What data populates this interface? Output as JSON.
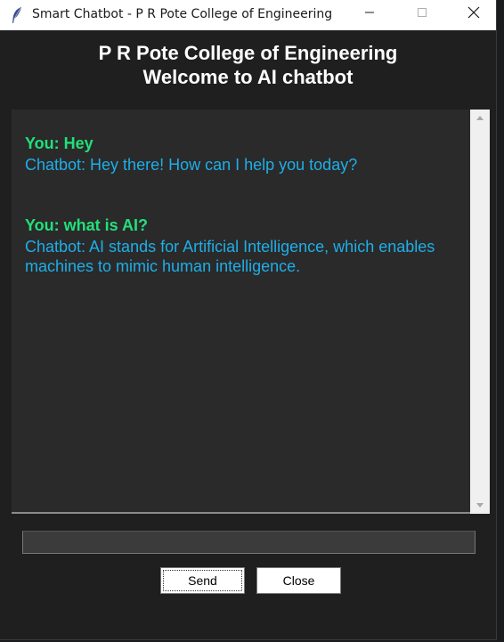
{
  "window": {
    "title": "Smart Chatbot - P R Pote College of Engineering",
    "icons": {
      "app": "feather-icon",
      "minimize": "minimize-icon",
      "maximize": "maximize-icon",
      "close": "close-icon"
    }
  },
  "header": {
    "line1": "P R Pote College of Engineering",
    "line2": "Welcome to AI chatbot"
  },
  "chat": {
    "messages": [
      {
        "role": "user",
        "text": "You: Hey"
      },
      {
        "role": "bot",
        "text": "Chatbot: Hey there! How can I help you today?"
      },
      {
        "role": "user",
        "text": "You: what is AI?"
      },
      {
        "role": "bot",
        "text": "Chatbot: AI stands for Artificial Intelligence, which enables machines to mimic human intelligence."
      }
    ]
  },
  "input": {
    "value": "",
    "placeholder": ""
  },
  "buttons": {
    "send": "Send",
    "close": "Close"
  },
  "colors": {
    "background": "#1f1f1f",
    "chat_background": "#2a2a2a",
    "user_text": "#22e07a",
    "bot_text": "#1eaee8"
  }
}
